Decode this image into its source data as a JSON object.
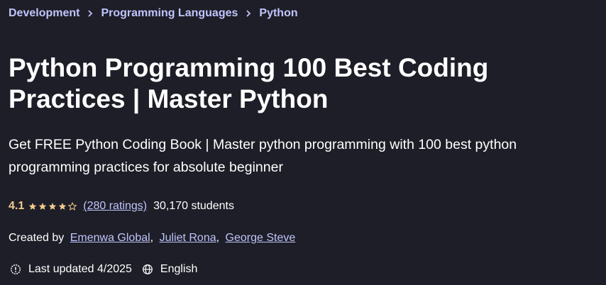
{
  "breadcrumb": {
    "items": [
      {
        "label": "Development"
      },
      {
        "label": "Programming Languages"
      },
      {
        "label": "Python"
      }
    ]
  },
  "course": {
    "title": "Python Programming 100 Best Coding Practices | Master Python",
    "subtitle": "Get FREE Python Coding Book | Master python programming with 100 best python programming practices for absolute beginner",
    "rating": {
      "value": "4.1",
      "stars": 4.1,
      "stars_max": 5,
      "ratings_link": "(280 ratings)",
      "students": "30,170 students"
    },
    "created_by": {
      "prefix": "Created by",
      "instructors": [
        {
          "name": "Emenwa Global"
        },
        {
          "name": "Juliet Rona"
        },
        {
          "name": "George Steve"
        }
      ],
      "separator": ","
    },
    "meta": {
      "last_updated": "Last updated 4/2025",
      "language": "English"
    }
  },
  "colors": {
    "background": "#1d1e27",
    "link": "#c0c4fc",
    "rating": "#f3ca8c",
    "text": "#ffffff"
  }
}
